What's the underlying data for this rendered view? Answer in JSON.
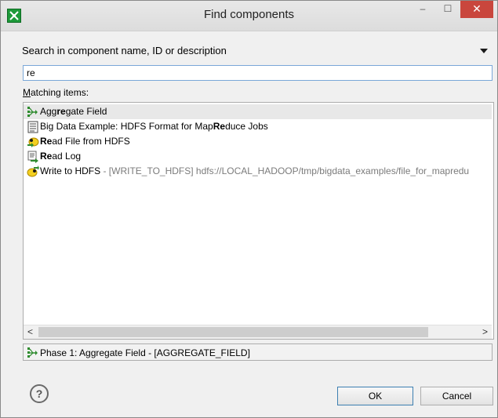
{
  "window": {
    "title": "Find components",
    "minimize_glyph": "–",
    "maximize_glyph": "☐",
    "close_glyph": "✕"
  },
  "search": {
    "label": "Search in component name, ID or description",
    "value": "re"
  },
  "matching": {
    "label_underlined": "M",
    "label_rest": "atching items:"
  },
  "items": [
    {
      "icon": "aggregate-icon",
      "parts": [
        "Agg",
        "re",
        "gate Field"
      ],
      "extra": ""
    },
    {
      "icon": "document-icon",
      "parts": [
        "Big Data Example: HDFS Format for Map",
        "Re",
        "duce Jobs"
      ],
      "extra": ""
    },
    {
      "icon": "read-file-icon",
      "parts": [
        "",
        "Re",
        "ad File from HDFS"
      ],
      "extra": ""
    },
    {
      "icon": "read-log-icon",
      "parts": [
        "",
        "Re",
        "ad Log"
      ],
      "extra": ""
    },
    {
      "icon": "write-hdfs-icon",
      "parts": [
        "Write to HDFS",
        "",
        ""
      ],
      "extra": " - [WRITE_TO_HDFS] hdfs://LOCAL_HADOOP/tmp/bigdata_examples/file_for_mapredu"
    }
  ],
  "scroll": {
    "left_glyph": "<",
    "right_glyph": ">"
  },
  "status": {
    "icon": "aggregate-icon",
    "text": "Phase 1: Aggregate Field - [AGGREGATE_FIELD]"
  },
  "buttons": {
    "help": "?",
    "ok": "OK",
    "cancel": "Cancel"
  },
  "colors": {
    "close_red": "#c9463d",
    "focus_blue": "#7aa7d8",
    "muted_text": "#7b7b7b"
  }
}
